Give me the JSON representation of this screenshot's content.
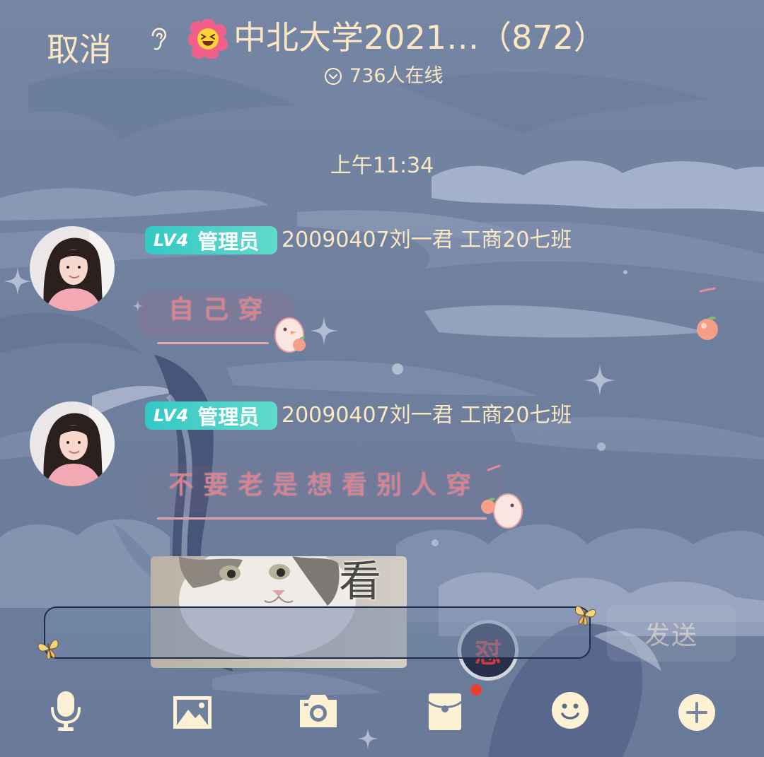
{
  "theme": {
    "background": "#7080a0",
    "text": "#fbe7c1",
    "badge": "#33c9c4",
    "bubble_text": "#e57d88",
    "icon": "#fdf1d3",
    "unread_dot": "#e8402f",
    "input_border": "#1d2b4d"
  },
  "header": {
    "cancel_label": "取消",
    "title": "中北大学2021…（872）",
    "online_text": "736人在线",
    "icons": [
      "ear-icon",
      "flower-emoji-icon",
      "chevron-down-icon"
    ]
  },
  "timestamp": "上午11:34",
  "messages": [
    {
      "level": "LV4",
      "role": "管理员",
      "sender": "20090407刘一君 工商20七班",
      "text": "自己穿"
    },
    {
      "level": "LV4",
      "role": "管理员",
      "sender": "20090407刘一君 工商20七班",
      "text": "不要老是想看别人穿"
    }
  ],
  "sticker": {
    "caption": "看"
  },
  "floating_sticker": {
    "text": "怼"
  },
  "composer": {
    "value": "",
    "send_label": "发送"
  },
  "toolbar": {
    "items": [
      "microphone-icon",
      "image-icon",
      "camera-icon",
      "red-envelope-icon",
      "emoji-icon",
      "plus-icon"
    ],
    "unread_dot_on": "red-envelope-icon"
  }
}
